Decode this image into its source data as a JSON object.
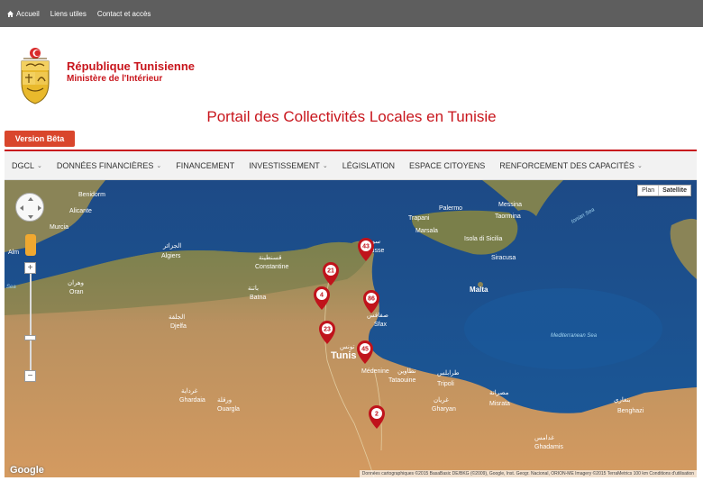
{
  "topbar": {
    "links": [
      {
        "label": "Accueil"
      },
      {
        "label": "Liens utiles"
      },
      {
        "label": "Contact et accès"
      }
    ]
  },
  "header": {
    "republic": "République Tunisienne",
    "ministry": "Ministère de l'Intérieur",
    "portal_title": "Portail des Collectivités Locales en Tunisie",
    "beta_label": "Version Bêta"
  },
  "nav": {
    "items": [
      {
        "label": "DGCL",
        "dropdown": true
      },
      {
        "label": "DONNÉES FINANCIÈRES",
        "dropdown": true
      },
      {
        "label": "FINANCEMENT",
        "dropdown": false
      },
      {
        "label": "INVESTISSEMENT",
        "dropdown": true
      },
      {
        "label": "LÉGISLATION",
        "dropdown": false
      },
      {
        "label": "ESPACE CITOYENS",
        "dropdown": false
      },
      {
        "label": "RENFORCEMENT DES CAPACITÉS",
        "dropdown": true
      }
    ]
  },
  "map": {
    "type_buttons": {
      "plan": "Plan",
      "satellite": "Satellite"
    },
    "attribution": "Données cartographiques ©2015 BasaBasic DE/BKG (©2009), Google, Inst. Geogr. Nacional, ORION-ME Imagery ©2015 TerraMetrics   100 km   Conditions d'utilisation",
    "google_label": "Google",
    "zoom_in": "+",
    "zoom_out": "−",
    "labels": {
      "benidorm": "Benidorm",
      "alicante": "Alicante",
      "murcia": "Murcia",
      "almeria": "Alm",
      "alger_ar": "الجزائر",
      "algiers": "Algiers",
      "oran_ar": "وهران",
      "oran": "Oran",
      "constantine_ar": "قسنطينة",
      "constantine": "Constantine",
      "batna_ar": "باتنة",
      "batna": "Batna",
      "djelfa_ar": "الجلفة",
      "djelfa": "Djelfa",
      "ghardaia_ar": "غرداية",
      "ghardaia": "Ghardaia",
      "ouargla_ar": "ورقلة",
      "ouargla": "Ouargla",
      "tunis_ar": "تونس",
      "tunis": "Tunis",
      "sousse_ar": "سوسة",
      "sousse": "Sousse",
      "sfax_ar": "صفاقس",
      "sfax": "Sfax",
      "medenine": "Médenine",
      "tataouine_ar": "تطاوين",
      "tataouine": "Tataouine",
      "ghadamis_ar": "غدامس",
      "ghadamis": "Ghadamis",
      "tripoli_ar": "طرابلس",
      "tripoli": "Tripoli",
      "gharyan_ar": "غريان",
      "gharyan": "Gharyan",
      "misrata_ar": "مصراتة",
      "misrata": "Misrata",
      "benghazi_ar": "بنغازي",
      "benghazi": "Benghazi",
      "palermo": "Palermo",
      "messina": "Messina",
      "taormina": "Taormina",
      "trapani": "Trapani",
      "marsala": "Marsala",
      "sicily": "Isola di Sicilia",
      "siracusa": "Siracusa",
      "malta": "Malta",
      "ionian": "Ionian Sea",
      "mediterranean": "Mediterranean Sea",
      "sea_left": "Sea"
    },
    "markers": [
      {
        "label": "43"
      },
      {
        "label": "21"
      },
      {
        "label": "4"
      },
      {
        "label": "86"
      },
      {
        "label": "23"
      },
      {
        "label": "45"
      },
      {
        "label": "2"
      }
    ]
  },
  "colors": {
    "brand_red": "#c8161d",
    "beta_orange": "#d9462c",
    "topbar_grey": "#5e5e5e",
    "sea": "#1f4f8a",
    "land": "#b98b55",
    "marker": "#c0131b"
  }
}
